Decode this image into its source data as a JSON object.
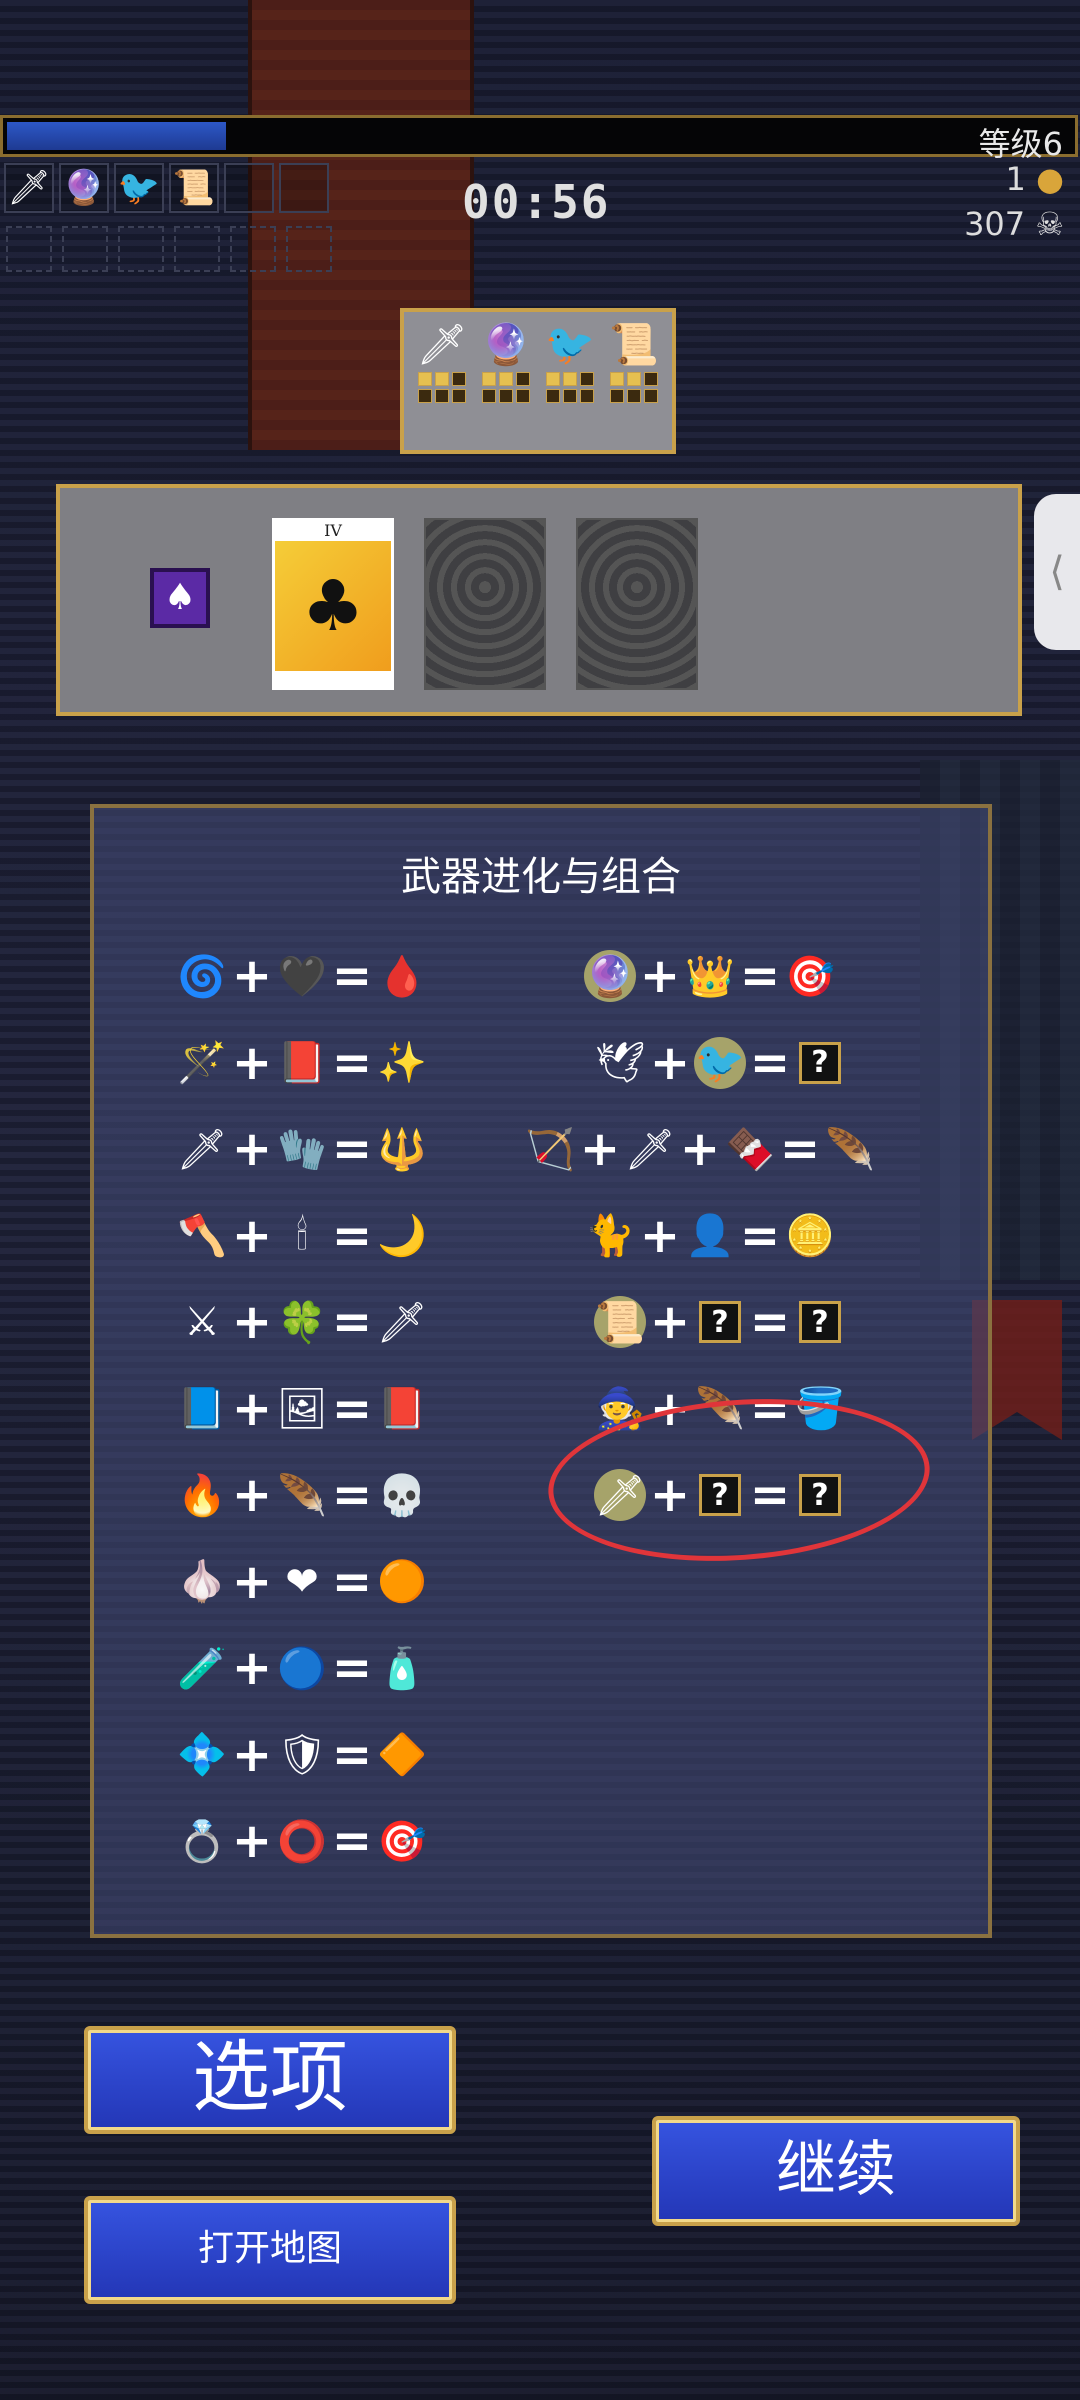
{
  "hud": {
    "level": "等级6",
    "xp_progress": 0.205,
    "timer": "00:56",
    "gold": "1",
    "kills": "307",
    "weapon_slots": [
      "spear",
      "magic-circle",
      "crow",
      "scroll",
      "",
      ""
    ]
  },
  "weapon_levels": {
    "weapons": [
      {
        "icon": "spear-icon",
        "glyph": "🗡",
        "level": 2
      },
      {
        "icon": "magic-circle-icon",
        "glyph": "🔮",
        "level": 2
      },
      {
        "icon": "crow-icon",
        "glyph": "🐦",
        "level": 2
      },
      {
        "icon": "scroll-icon",
        "glyph": "📜",
        "level": 2
      }
    ]
  },
  "arcana": {
    "card_numeral": "IV",
    "card_glyph": "♣"
  },
  "evolution": {
    "title": "武器进化与组合",
    "left": [
      [
        "🌀",
        "🖤",
        "🩸"
      ],
      [
        "🪄",
        "📕",
        "✨"
      ],
      [
        "🗡",
        "🧤",
        "🔱"
      ],
      [
        "🪓",
        "🕯",
        "🌙"
      ],
      [
        "⚔",
        "🍀",
        "🗡"
      ],
      [
        "📘",
        "🖼",
        "📕"
      ],
      [
        "🔥",
        "🪶",
        "💀"
      ],
      [
        "🧄",
        "❤",
        "🟠"
      ],
      [
        "🧪",
        "🔵",
        "🧴"
      ],
      [
        "💠",
        "🛡",
        "🔶"
      ],
      [
        "💍",
        "⭕",
        "🎯"
      ]
    ],
    "right": [
      [
        "🔮",
        "👑",
        "🎯"
      ],
      [
        "🕊",
        "🐦",
        "?"
      ],
      [
        "🏹",
        "🗡",
        "🍫",
        "🪶"
      ],
      [
        "🐈",
        "👤",
        "🪙"
      ],
      [
        "📜",
        "?",
        "?"
      ],
      [
        "🧙",
        "🪶",
        "🪣"
      ],
      [
        "🗡",
        "?",
        "?"
      ]
    ]
  },
  "buttons": {
    "options": "选项",
    "open_map": "打开地图",
    "continue": "继续"
  },
  "colors": {
    "accent_gold": "#c9a14a",
    "button_blue": "#2f47d0",
    "annotation_red": "#e0353a"
  }
}
